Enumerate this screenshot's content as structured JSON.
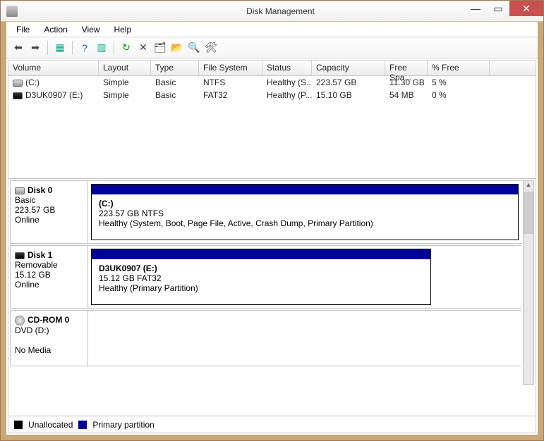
{
  "window": {
    "title": "Disk Management"
  },
  "menu": {
    "file": "File",
    "action": "Action",
    "view": "View",
    "help": "Help"
  },
  "columns": {
    "volume": "Volume",
    "layout": "Layout",
    "type": "Type",
    "fs": "File System",
    "status": "Status",
    "capacity": "Capacity",
    "free": "Free Spa...",
    "pct": "% Free"
  },
  "volumes": [
    {
      "name": "(C:)",
      "layout": "Simple",
      "type": "Basic",
      "fs": "NTFS",
      "status": "Healthy (S...",
      "capacity": "223.57 GB",
      "free": "11.30 GB",
      "pct": "5 %"
    },
    {
      "name": "D3UK0907 (E:)",
      "layout": "Simple",
      "type": "Basic",
      "fs": "FAT32",
      "status": "Healthy (P...",
      "capacity": "15.10 GB",
      "free": "54 MB",
      "pct": "0 %"
    }
  ],
  "disks": {
    "d0": {
      "name": "Disk 0",
      "type": "Basic",
      "size": "223.57 GB",
      "state": "Online",
      "partName": "(C:)",
      "partInfo": "223.57 GB NTFS",
      "partStatus": "Healthy (System, Boot, Page File, Active, Crash Dump, Primary Partition)"
    },
    "d1": {
      "name": "Disk 1",
      "type": "Removable",
      "size": "15.12 GB",
      "state": "Online",
      "partName": "D3UK0907  (E:)",
      "partInfo": "15.12 GB FAT32",
      "partStatus": "Healthy (Primary Partition)"
    },
    "cd": {
      "name": "CD-ROM 0",
      "type": "DVD (D:)",
      "state": "No Media"
    }
  },
  "legend": {
    "unallocated": "Unallocated",
    "primary": "Primary partition"
  }
}
